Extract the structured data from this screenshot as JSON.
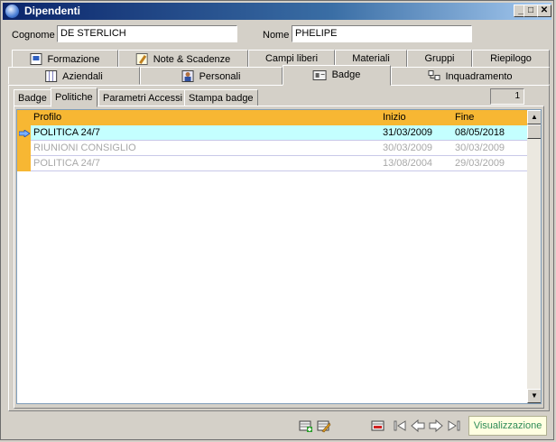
{
  "window": {
    "title": "Dipendenti"
  },
  "form": {
    "cognome_label": "Cognome",
    "cognome_value": "DE STERLICH",
    "nome_label": "Nome",
    "nome_value": "PHELIPE"
  },
  "tabs_row1": [
    {
      "label": "Formazione",
      "icon": "certificate-icon"
    },
    {
      "label": "Note & Scadenze",
      "icon": "note-edit-icon"
    },
    {
      "label": "Campi liberi"
    },
    {
      "label": "Materiali"
    },
    {
      "label": "Gruppi"
    },
    {
      "label": "Riepilogo"
    }
  ],
  "tabs_row2": [
    {
      "label": "Aziendali",
      "icon": "grid-icon"
    },
    {
      "label": "Personali",
      "icon": "person-icon"
    },
    {
      "label": "Badge",
      "icon": "badge-card-icon"
    },
    {
      "label": "Inquadramento",
      "icon": "hierarchy-icon"
    }
  ],
  "subtabs": [
    "Badge",
    "Politiche",
    "Parametri Accessi",
    "Stampa badge"
  ],
  "counter": "1",
  "grid": {
    "columns": [
      "Profilo",
      "Inizio",
      "Fine"
    ],
    "rows": [
      {
        "profilo": "POLITICA 24/7",
        "inizio": "31/03/2009",
        "fine": "08/05/2018"
      },
      {
        "profilo": "RIUNIONI CONSIGLIO",
        "inizio": "30/03/2009",
        "fine": "30/03/2009"
      },
      {
        "profilo": "POLITICA 24/7",
        "inizio": "13/08/2004",
        "fine": "29/03/2009"
      }
    ]
  },
  "status": "Visualizzazione",
  "colors": {
    "accent": "#f7b733",
    "selected_row": "#c4ffff",
    "title_bar": "#0a246a",
    "status_text": "#2e8b57"
  }
}
